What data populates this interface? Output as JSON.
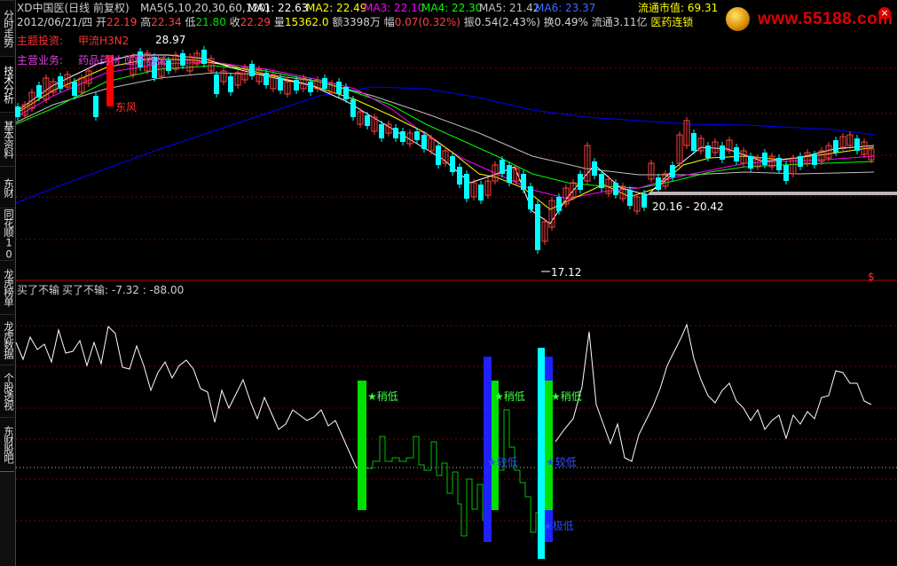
{
  "sidebar": {
    "tabs": [
      {
        "label": "分时走势"
      },
      {
        "label": "技术分析"
      },
      {
        "label": "基本资料"
      },
      {
        "label": "东财10"
      },
      {
        "label": "同花顺10"
      },
      {
        "label": "龙虎榜单"
      },
      {
        "label": "龙虎数据"
      },
      {
        "label": "个股透视"
      },
      {
        "label": "东财股吧"
      }
    ]
  },
  "header": {
    "stock_name": "XD中国医(日线 前复权)",
    "ma_label": "MA5(5,10,20,30,60,120)",
    "ma1": "MA1: 22.63",
    "ma2": "MA2: 22.49",
    "ma3": "MA3: 22.10",
    "ma4": "MA4: 22.30",
    "ma5": "MA5: 21.42",
    "ma6": "MA6: 23.37",
    "float_cap": "流通市值: 69.31",
    "date": "2012/06/21/四",
    "open_label": "开",
    "open": "22.19",
    "high_label": "高",
    "high": "22.34",
    "low_label": "低",
    "low": "21.80",
    "close_label": "收",
    "close": "22.29",
    "vol_label": "量",
    "vol": "15362.0",
    "amount": "额3398万",
    "change_label": "幅",
    "change": "0.07(0.32%)",
    "amplitude": "振0.54(2.43%)",
    "turnover": "换0.49%",
    "float_shares": "流通3.11亿",
    "sector": "医药连锁",
    "theme_label": "主题投资:",
    "theme_value": "甲流H3N2",
    "business_label": "主营业务:",
    "business_value": "药品药材 医疗器械"
  },
  "colors": {
    "ma1": "#ffffff",
    "ma2": "#ffff00",
    "ma3": "#ff00ff",
    "ma4": "#00ff00",
    "ma5": "#c0c0c0",
    "ma6": "#0000ff",
    "up": "#ff4040",
    "down": "#00ffff"
  },
  "annotations": {
    "high_price": "28.97",
    "flag_label": "东风",
    "range_label": "20.16 - 20.42",
    "low_price": "17.12",
    "dollar_mark": "$"
  },
  "indicator": {
    "title": "买了不输",
    "value_line": "买了不输: -7.32 : -88.00",
    "signals": {
      "low1": "稍低",
      "low2": "稍低",
      "low3": "稍低",
      "mid1": "较低",
      "mid2": "较低",
      "extreme": "极低"
    }
  },
  "logo": {
    "text": "www.55188.com",
    "close": "×"
  }
}
